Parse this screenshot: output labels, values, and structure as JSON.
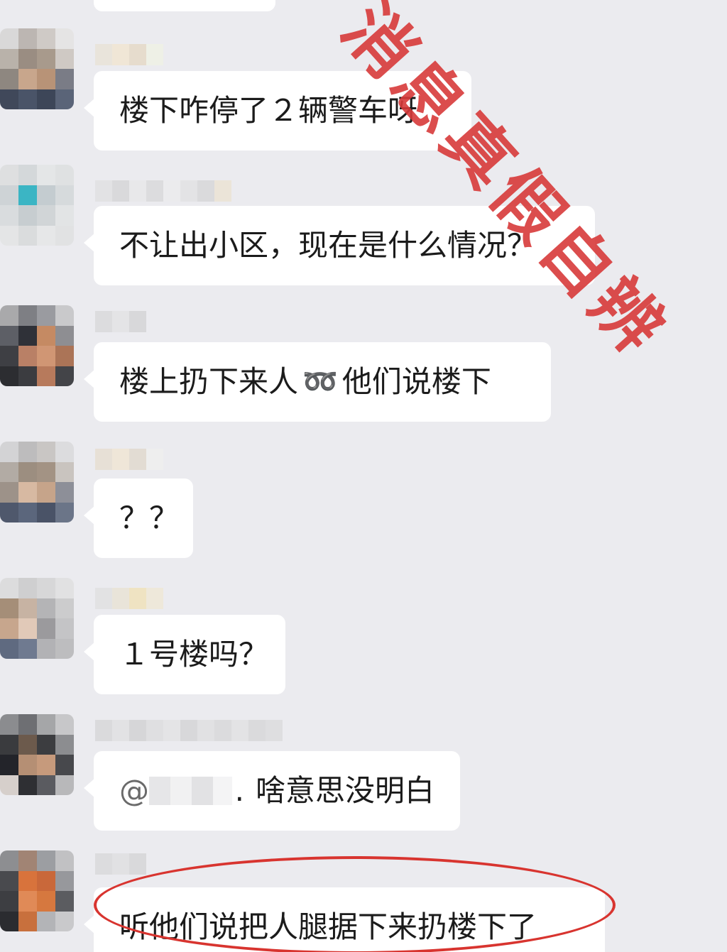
{
  "watermark": {
    "text": "消息真假自辨",
    "color": "#d83a3a"
  },
  "messages": [
    {
      "text": "楼下咋停了２辆警车呀"
    },
    {
      "text": "不让出小区，现在是什么情况？"
    },
    {
      "text_before": "楼上扔下来人",
      "emoji": "arm-emoji",
      "text_after": "他们说楼下"
    },
    {
      "text": "？？"
    },
    {
      "text": "１号楼吗？"
    },
    {
      "text_prefix": "@",
      "text_mid": ".",
      "text": "啥意思没明白"
    },
    {
      "text": "听他们说把人腿据下来扔楼下了",
      "highlight_color": "#d8342f"
    }
  ]
}
